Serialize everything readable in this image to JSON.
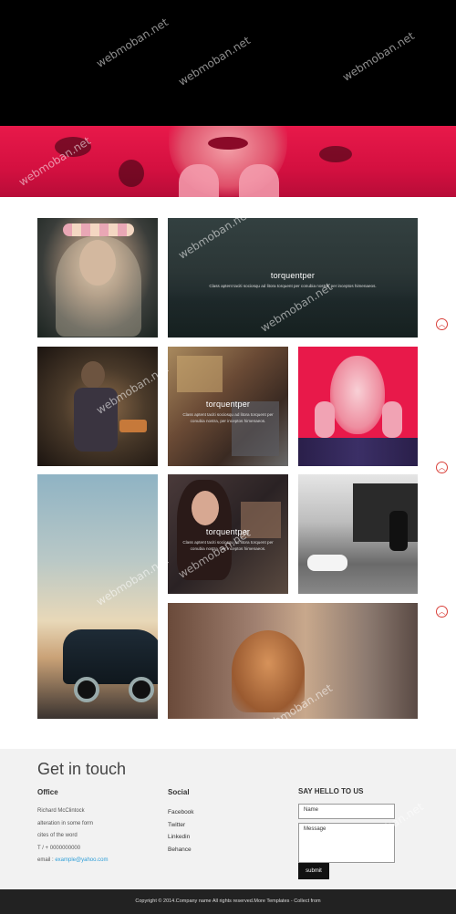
{
  "tiles": [
    {
      "caption_title": "",
      "caption_text": ""
    },
    {
      "caption_title": "torquentper",
      "caption_text": "Class aptent taciti sociosqu ad litora torquent per conubia nostra, per inceptos himenaeos."
    },
    {
      "caption_title": "",
      "caption_text": ""
    },
    {
      "caption_title": "torquentper",
      "caption_text": "Class aptent taciti sociosqu ad litora torquent per conubia nostra, per inceptos himenaeos."
    },
    {
      "caption_title": "",
      "caption_text": ""
    },
    {
      "caption_title": "",
      "caption_text": ""
    },
    {
      "caption_title": "torquentper",
      "caption_text": "Class aptent taciti sociosqu ad litora torquent per conubia nostra, per inceptos himenaeos."
    },
    {
      "caption_title": "",
      "caption_text": ""
    },
    {
      "caption_title": "",
      "caption_text": ""
    }
  ],
  "scroll_up_icon": "chevron-up-icon",
  "footer": {
    "heading": "Get in touch",
    "office": {
      "title": "Office",
      "name": "Richard McClintock",
      "line1": "alteration in some form",
      "line2": "cites of the word",
      "phone": "T / + 0000000000",
      "email_label": "email : ",
      "email": "example@yahoo.com"
    },
    "social": {
      "title": "Social",
      "items": [
        "Facebook",
        "Twitter",
        "Linkedin",
        "Behance"
      ]
    },
    "contact": {
      "title": "SAY HELLO TO US",
      "name_placeholder": "Name",
      "message_placeholder": "Message",
      "submit_label": "submit"
    },
    "copyright": "Copyright © 2014.Company name All rights reserved.More Templates",
    "collect": "- Collect from"
  },
  "watermark": "webmoban.net",
  "colors": {
    "accent": "#d9413b",
    "hero_red": "#e8194a",
    "link": "#2f9fd8"
  }
}
